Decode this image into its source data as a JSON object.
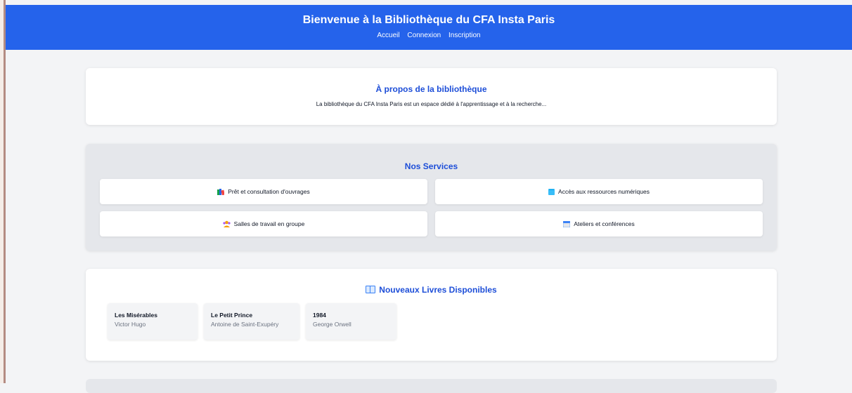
{
  "header": {
    "title": "Bienvenue à la Bibliothèque du CFA Insta Paris",
    "nav": [
      "Accueil",
      "Connexion",
      "Inscription"
    ]
  },
  "about": {
    "title": "À propos de la bibliothèque",
    "text": "La bibliothèque du CFA Insta Paris est un espace dédié à l'apprentissage et à la recherche..."
  },
  "services": {
    "title": "Nos Services",
    "items": [
      {
        "label": "Prêt et consultation d'ouvrages",
        "icon": "books-icon"
      },
      {
        "label": "Accès aux ressources numériques",
        "icon": "blue-book-icon"
      },
      {
        "label": "Salles de travail en groupe",
        "icon": "group-icon"
      },
      {
        "label": "Ateliers et conférences",
        "icon": "calendar-icon"
      }
    ]
  },
  "books": {
    "title": "Nouveaux Livres Disponibles",
    "icon": "open-book-icon",
    "items": [
      {
        "title": "Les Misérables",
        "author": "Victor Hugo"
      },
      {
        "title": "Le Petit Prince",
        "author": "Antoine de Saint-Exupéry"
      },
      {
        "title": "1984",
        "author": "George Orwell"
      }
    ]
  },
  "colors": {
    "primary": "#2563eb",
    "heading": "#1d4ed8",
    "background": "#f3f4f6"
  }
}
